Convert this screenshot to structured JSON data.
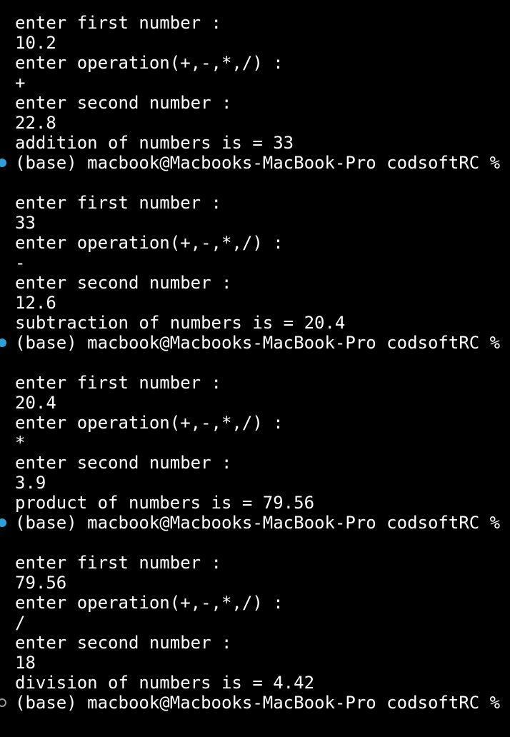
{
  "terminal": {
    "lines": [
      {
        "text": "enter first number :",
        "marker": "none"
      },
      {
        "text": "10.2",
        "marker": "none"
      },
      {
        "text": "enter operation(+,-,*,/) :",
        "marker": "none"
      },
      {
        "text": "+",
        "marker": "none"
      },
      {
        "text": "enter second number :",
        "marker": "none"
      },
      {
        "text": "22.8",
        "marker": "none"
      },
      {
        "text": "addition of numbers is = 33",
        "marker": "none"
      },
      {
        "text": "(base) macbook@Macbooks-MacBook-Pro codsoftRC % co",
        "marker": "filled"
      },
      {
        "text": "",
        "marker": "none"
      },
      {
        "text": "enter first number :",
        "marker": "none"
      },
      {
        "text": "33",
        "marker": "none"
      },
      {
        "text": "enter operation(+,-,*,/) :",
        "marker": "none"
      },
      {
        "text": "-",
        "marker": "none"
      },
      {
        "text": "enter second number :",
        "marker": "none"
      },
      {
        "text": "12.6",
        "marker": "none"
      },
      {
        "text": "subtraction of numbers is = 20.4",
        "marker": "none"
      },
      {
        "text": "(base) macbook@Macbooks-MacBook-Pro codsoftRC % co",
        "marker": "filled"
      },
      {
        "text": "",
        "marker": "none"
      },
      {
        "text": "enter first number :",
        "marker": "none"
      },
      {
        "text": "20.4",
        "marker": "none"
      },
      {
        "text": "enter operation(+,-,*,/) :",
        "marker": "none"
      },
      {
        "text": "*",
        "marker": "none"
      },
      {
        "text": "enter second number :",
        "marker": "none"
      },
      {
        "text": "3.9",
        "marker": "none"
      },
      {
        "text": "product of numbers is = 79.56",
        "marker": "none"
      },
      {
        "text": "(base) macbook@Macbooks-MacBook-Pro codsoftRC % co",
        "marker": "filled"
      },
      {
        "text": "",
        "marker": "none"
      },
      {
        "text": "enter first number :",
        "marker": "none"
      },
      {
        "text": "79.56",
        "marker": "none"
      },
      {
        "text": "enter operation(+,-,*,/) :",
        "marker": "none"
      },
      {
        "text": "/",
        "marker": "none"
      },
      {
        "text": "enter second number :",
        "marker": "none"
      },
      {
        "text": "18",
        "marker": "none"
      },
      {
        "text": "division of numbers is = 4.42",
        "marker": "none"
      },
      {
        "text": "(base) macbook@Macbooks-MacBook-Pro codsoftRC %",
        "marker": "hollow",
        "cursor": true
      }
    ],
    "colors": {
      "background": "#000000",
      "text": "#ffffff",
      "marker_filled": "#2f9fd8",
      "marker_hollow": "#9a9a9a",
      "cursor": "#ffffff"
    }
  }
}
